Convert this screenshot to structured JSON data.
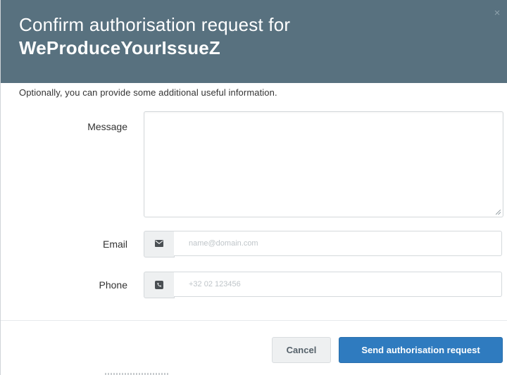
{
  "dialog": {
    "title_line1": "Confirm authorisation request for",
    "title_line2": "WeProduceYourIssueZ",
    "close_label": "×",
    "intro": "Optionally, you can provide some additional useful information."
  },
  "form": {
    "message": {
      "label": "Message",
      "value": ""
    },
    "email": {
      "label": "Email",
      "placeholder": "name@domain.com",
      "value": "",
      "icon": "envelope-icon"
    },
    "phone": {
      "label": "Phone",
      "placeholder": "+32 02 123456",
      "value": "",
      "icon": "phone-icon"
    }
  },
  "buttons": {
    "cancel_label": "Cancel",
    "send_label": "Send authorisation request"
  },
  "colors": {
    "header_bg": "#58717f",
    "primary_button": "#2f7bbf",
    "addon_bg": "#eef0f1"
  }
}
